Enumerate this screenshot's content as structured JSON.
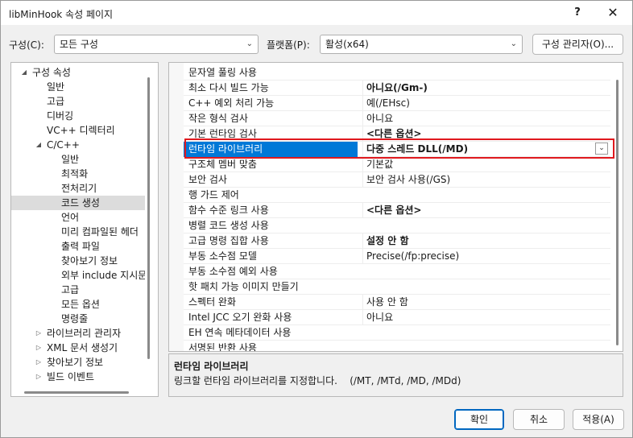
{
  "window": {
    "title": "libMinHook 속성 페이지",
    "help": "?",
    "close": "✕"
  },
  "config_bar": {
    "config_label": "구성(C):",
    "config_value": "모든 구성",
    "platform_label": "플랫폼(P):",
    "platform_value": "활성(x64)",
    "manager_button": "구성 관리자(O)..."
  },
  "tree": {
    "items": [
      {
        "label": "구성 속성",
        "level": 0,
        "expanded": true
      },
      {
        "label": "일반",
        "level": 1
      },
      {
        "label": "고급",
        "level": 1
      },
      {
        "label": "디버깅",
        "level": 1
      },
      {
        "label": "VC++ 디렉터리",
        "level": 1
      },
      {
        "label": "C/C++",
        "level": 1,
        "expanded": true
      },
      {
        "label": "일반",
        "level": 2
      },
      {
        "label": "최적화",
        "level": 2
      },
      {
        "label": "전처리기",
        "level": 2
      },
      {
        "label": "코드 생성",
        "level": 2,
        "selected": true
      },
      {
        "label": "언어",
        "level": 2
      },
      {
        "label": "미리 컴파일된 헤더",
        "level": 2
      },
      {
        "label": "출력 파일",
        "level": 2
      },
      {
        "label": "찾아보기 정보",
        "level": 2
      },
      {
        "label": "외부 include 지시문",
        "level": 2
      },
      {
        "label": "고급",
        "level": 2
      },
      {
        "label": "모든 옵션",
        "level": 2
      },
      {
        "label": "명령줄",
        "level": 2
      },
      {
        "label": "라이브러리 관리자",
        "level": 1,
        "collapsed": true
      },
      {
        "label": "XML 문서 생성기",
        "level": 1,
        "collapsed": true
      },
      {
        "label": "찾아보기 정보",
        "level": 1,
        "collapsed": true
      },
      {
        "label": "빌드 이벤트",
        "level": 1,
        "collapsed": true
      }
    ]
  },
  "properties": [
    {
      "name": "문자열 풀링 사용",
      "value": ""
    },
    {
      "name": "최소 다시 빌드 가능",
      "value": "아니요(/Gm-)",
      "bold": true
    },
    {
      "name": "C++ 예외 처리 가능",
      "value": "예(/EHsc)"
    },
    {
      "name": "작은 형식 검사",
      "value": "아니요"
    },
    {
      "name": "기본 런타임 검사",
      "value": "<다른 옵션>",
      "bold": true
    },
    {
      "name": "런타임 라이브러리",
      "value": "다중 스레드 DLL(/MD)",
      "selected": true
    },
    {
      "name": "구조체 멤버 맞춤",
      "value": "기본값"
    },
    {
      "name": "보안 검사",
      "value": "보안 검사 사용(/GS)"
    },
    {
      "name": "행 가드 제어",
      "value": ""
    },
    {
      "name": "함수 수준 링크 사용",
      "value": "<다른 옵션>",
      "bold": true
    },
    {
      "name": "병렬 코드 생성 사용",
      "value": ""
    },
    {
      "name": "고급 명령 집합 사용",
      "value": "설정 안 함",
      "bold": true
    },
    {
      "name": "부동 소수점 모델",
      "value": "Precise(/fp:precise)"
    },
    {
      "name": "부동 소수점 예외 사용",
      "value": ""
    },
    {
      "name": "핫 패치 가능 이미지 만들기",
      "value": ""
    },
    {
      "name": "스펙터 완화",
      "value": "사용 안 함"
    },
    {
      "name": "Intel JCC 오기 완화 사용",
      "value": "아니요"
    },
    {
      "name": "EH 연속 메타데이터 사용",
      "value": ""
    },
    {
      "name": "서명된 반환 사용",
      "value": ""
    }
  ],
  "description": {
    "title": "런타임 라이브러리",
    "text": "링크할 런타임 라이브러리를 지정합니다.    (/MT, /MTd, /MD, /MDd)"
  },
  "buttons": {
    "ok": "확인",
    "cancel": "취소",
    "apply": "적용(A)"
  }
}
